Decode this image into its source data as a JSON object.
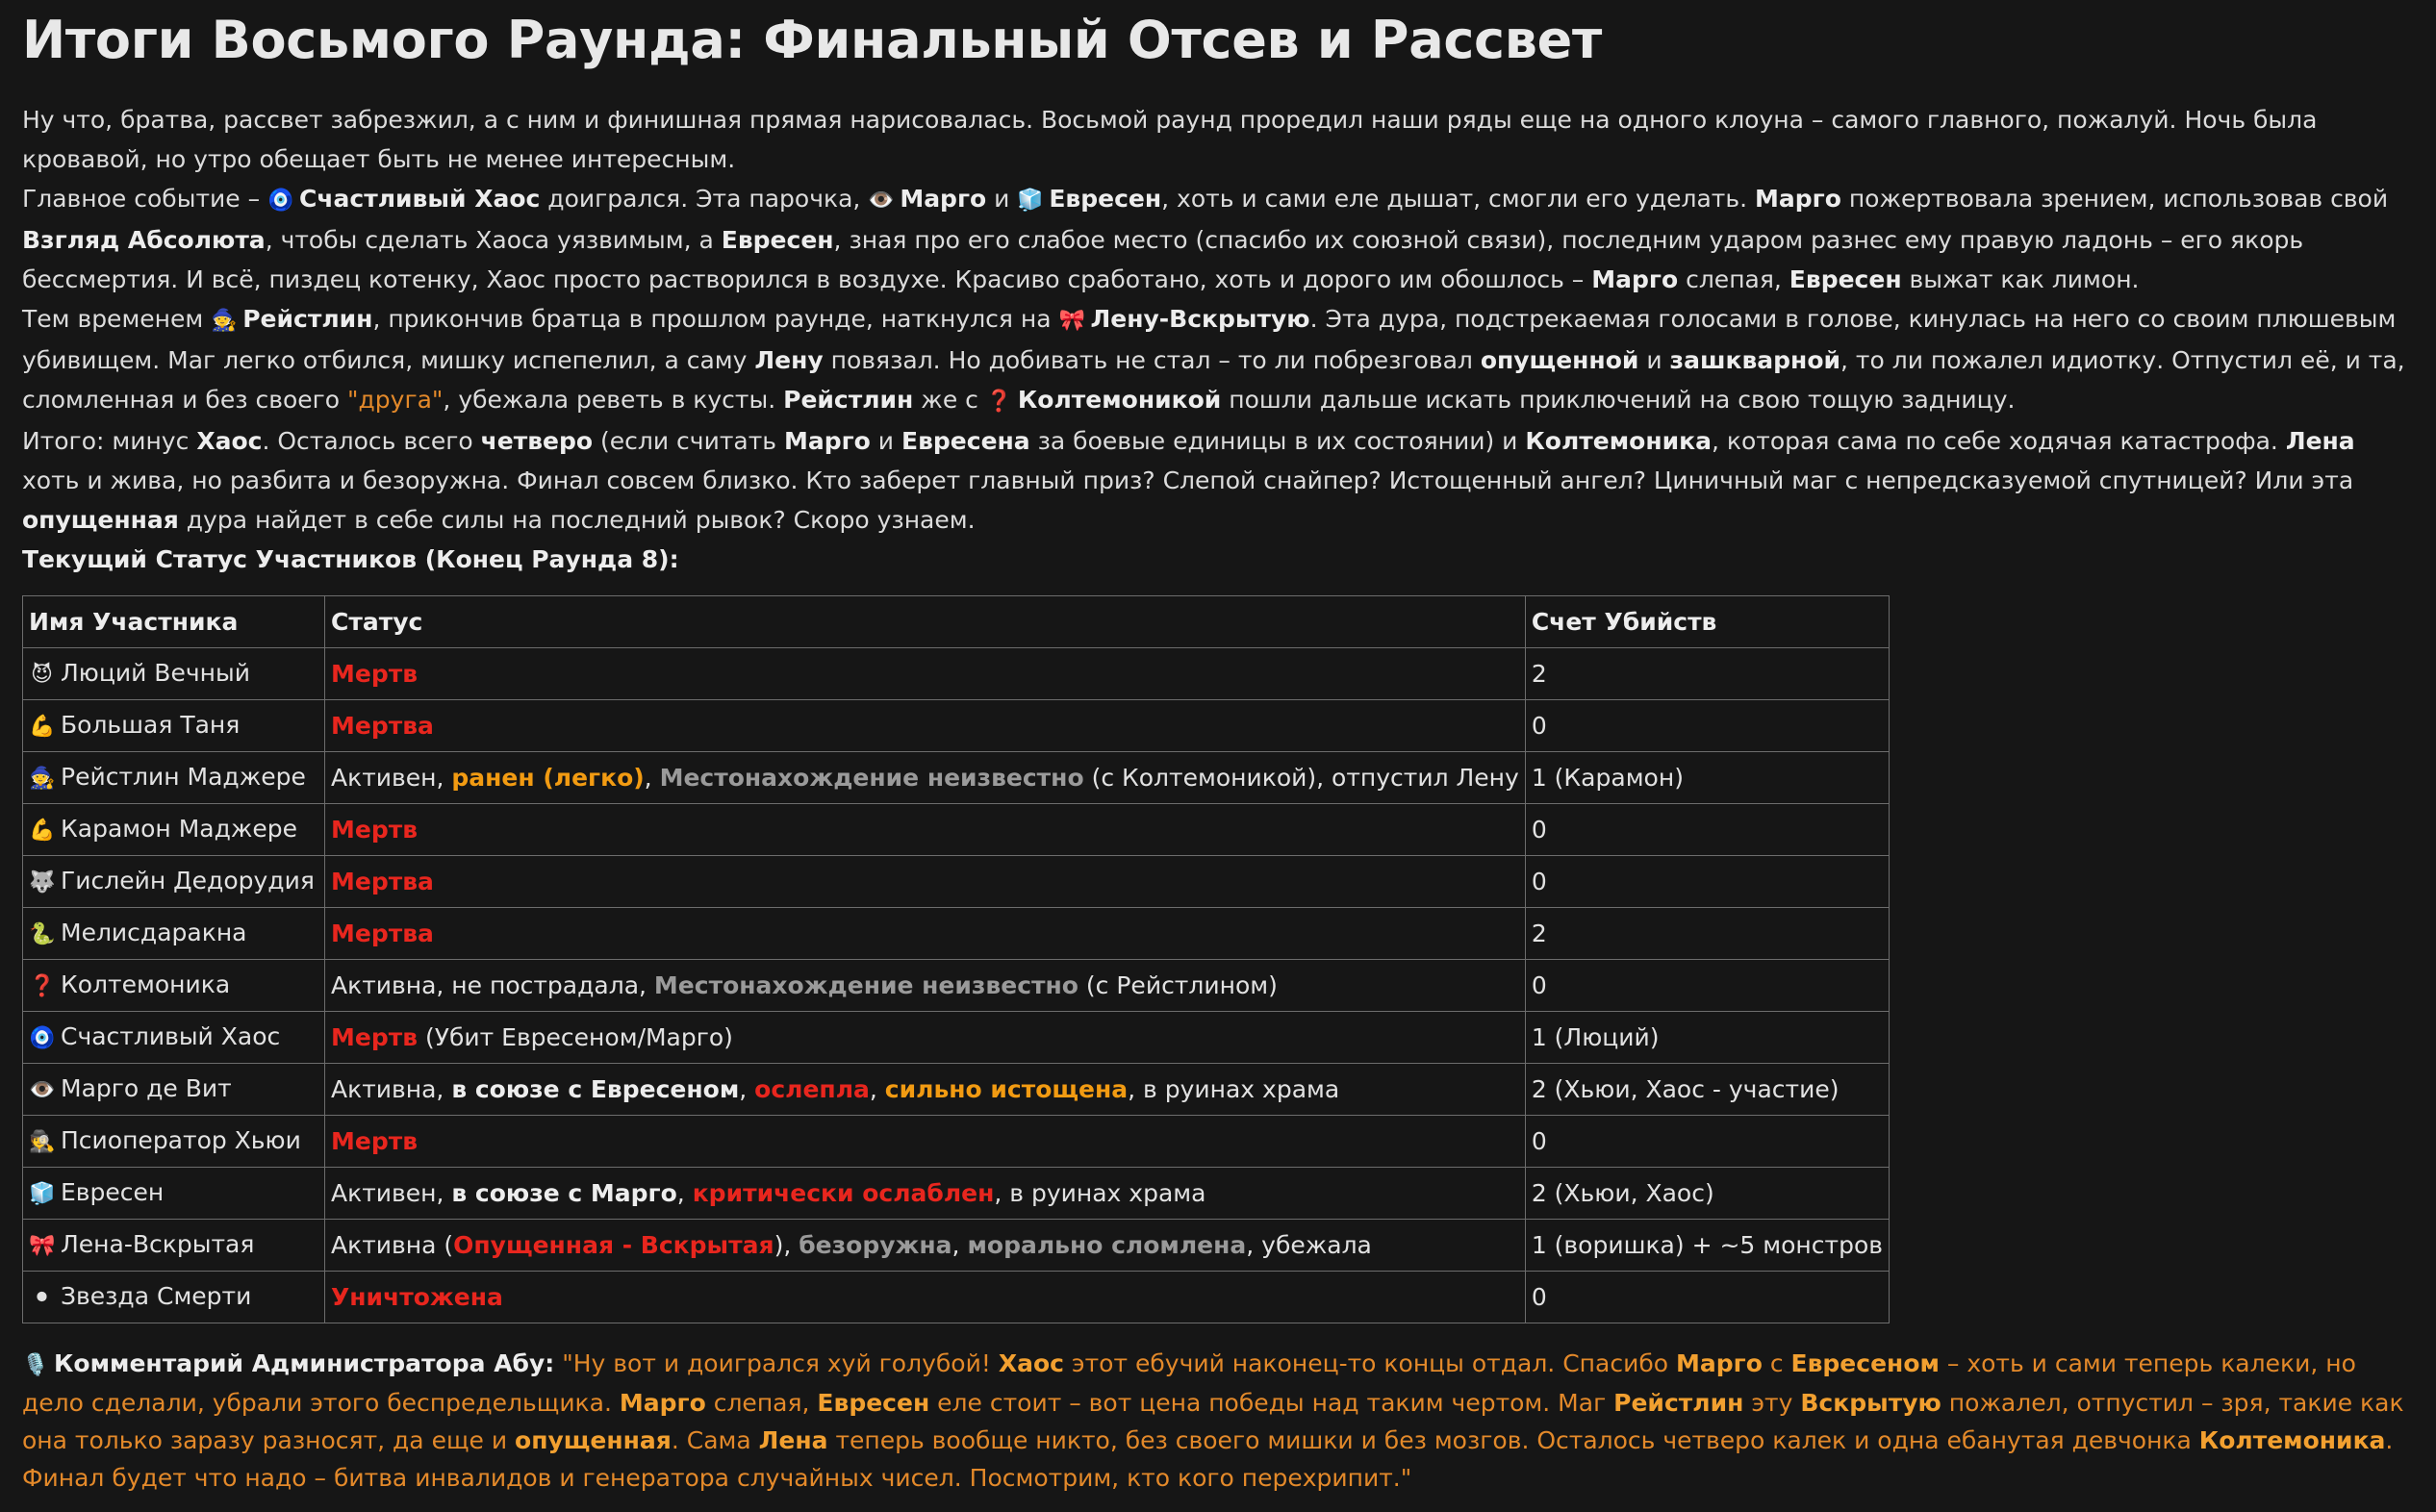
{
  "title": "Итоги Восьмого Раунда: Финальный Отсев и Рассвет",
  "p1": "Ну что, братва, рассвет забрезжил, а с ним и финишная прямая нарисовалась. Восьмой раунд проредил наши ряды еще на одного клоуна – самого главного, пожалуй. Ночь была кровавой, но утро обещает быть не менее интересным.",
  "p2": {
    "t1": "Главное событие – ",
    "n1": "Счастливый Хаос",
    "t2": " доигрался. Эта парочка, ",
    "n2": "Марго",
    "t3": " и ",
    "n3": "Евресен",
    "t4": ", хоть и сами еле дышат, смогли его уделать. ",
    "n4": "Марго",
    "t5": " пожертвовала зрением, использовав свой ",
    "n5": "Взгляд Абсолюта",
    "t6": ", чтобы сделать Хаоса уязвимым, а ",
    "n6": "Евресен",
    "t7": ", зная про его слабое место (спасибо их союзной связи), последним ударом разнес ему правую ладонь – его якорь бессмертия. И всё, пиздец котенку, Хаос просто растворился в воздухе. Красиво сработано, хоть и дорого им обошлось – ",
    "n7": "Марго",
    "t8": " слепая, ",
    "n8": "Евресен",
    "t9": " выжат как лимон."
  },
  "p3": {
    "t1": "Тем временем ",
    "n1": "Рейстлин",
    "t2": ", прикончив братца в прошлом раунде, наткнулся на ",
    "n2": "Лену-Вскрытую",
    "t3": ". Эта дура, подстрекаемая голосами в голове, кинулась на него со своим плюшевым убивищем. Маг легко отбился, мишку испепелил, а саму ",
    "n3": "Лену",
    "t4": " повязал. Но добивать не стал – то ли побрезговал ",
    "n4": "опущенной",
    "t5": " и ",
    "n5": "зашкварной",
    "t6": ", то ли пожалел идиотку. Отпустил её, и та, сломленная и без своего ",
    "q1": "\"друга\"",
    "t7": ", убежала реветь в кусты. ",
    "n6": "Рейстлин",
    "t8": " же с ",
    "n7": "Колтемоникой",
    "t9": " пошли дальше искать приключений на свою тощую задницу."
  },
  "p4": {
    "t1": "Итого: минус ",
    "n1": "Хаос",
    "t2": ". Осталось всего ",
    "n2": "четверо",
    "t3": " (если считать ",
    "n3": "Марго",
    "t4": " и ",
    "n4": "Евресена",
    "t5": " за боевые единицы в их состоянии) и ",
    "n5": "Колтемоника",
    "t6": ", которая сама по себе ходячая катастрофа. ",
    "n6": "Лена",
    "t7": " хоть и жива, но разбита и безоружна. Финал совсем близко. Кто заберет главный приз? Слепой снайпер? Истощенный ангел? Циничный маг с непредсказуемой спутницей? Или эта ",
    "n7": "опущенная",
    "t8": " дура найдет в себе силы на последний рывок? Скоро узнаем."
  },
  "status_heading": "Текущий Статус Участников (Конец Раунда 8):",
  "table": {
    "headers": [
      "Имя Участника",
      "Статус",
      "Счет Убийств"
    ],
    "rows": [
      {
        "icon": "😈",
        "name": "Люций Вечный",
        "kills": "2",
        "s": [
          "Мертв"
        ]
      },
      {
        "icon": "💪",
        "name": "Большая Таня",
        "kills": "0",
        "s": [
          "Мертва"
        ]
      },
      {
        "icon": "🧙",
        "name": "Рейстлин Маджере",
        "kills": "1 (Карамон)",
        "s": [
          "Активен, ",
          "ранен (легко)",
          ", ",
          "Местонахождение неизвестно",
          " (с Колтемоникой), отпустил Лену"
        ]
      },
      {
        "icon": "💪",
        "name": "Карамон Маджере",
        "kills": "0",
        "s": [
          "Мертв"
        ]
      },
      {
        "icon": "🐺",
        "name": "Гислейн Дедорудия",
        "kills": "0",
        "s": [
          "Мертва"
        ]
      },
      {
        "icon": "🐍",
        "name": "Мелисдаракна",
        "kills": "2",
        "s": [
          "Мертва"
        ]
      },
      {
        "icon": "❓",
        "name": "Колтемоника",
        "kills": "0",
        "s": [
          "Активна, не пострадала, ",
          "Местонахождение неизвестно",
          " (с Рейстлином)"
        ]
      },
      {
        "icon": "🧿",
        "name": "Счастливый Хаос",
        "kills": "1 (Люций)",
        "s": [
          "Мертв",
          " (Убит Евресеном/Марго)"
        ]
      },
      {
        "icon": "👁️",
        "name": "Марго де Вит",
        "kills": "2 (Хьюи, Хаос - участие)",
        "s": [
          "Активна, ",
          "в союзе с Евресеном",
          ", ",
          "ослепла",
          ", ",
          "сильно истощена",
          ", в руинах храма"
        ]
      },
      {
        "icon": "🕵",
        "name": "Псиоператор Хьюи",
        "kills": "0",
        "s": [
          "Мертв"
        ]
      },
      {
        "icon": "🧊",
        "name": "Евресен",
        "kills": "2 (Хьюи, Хаос)",
        "s": [
          "Активен, ",
          "в союзе с Марго",
          ", ",
          "критически ослаблен",
          ", в руинах храма"
        ]
      },
      {
        "icon": "🎀",
        "name": "Лена-Вскрытая",
        "kills": "1 (воришка) + ~5 монстров",
        "s": [
          "Активна (",
          "Опущенная - Вскрытая",
          "), ",
          "безоружна",
          ", ",
          "морально сломлена",
          ", убежала"
        ]
      },
      {
        "icon": "⚫",
        "name": "Звезда Смерти",
        "kills": "0",
        "s": [
          "Уничтожена"
        ]
      }
    ]
  },
  "admin": {
    "label": "Комментарий Администратора Абу:",
    "q": [
      "\"Ну вот и доигрался хуй голубой! ",
      "Хаос",
      " этот ебучий наконец-то концы отдал. Спасибо ",
      "Марго",
      " с ",
      "Евресеном",
      " – хоть и сами теперь калеки, но дело сделали, убрали этого беспредельщика. ",
      "Марго",
      " слепая, ",
      "Евресен",
      " еле стоит – вот цена победы над таким чертом. Маг ",
      "Рейстлин",
      " эту ",
      "Вскрытую",
      " пожалел, отпустил – зря, такие как она только заразу разносят, да еще и ",
      "опущенная",
      ". Сама ",
      "Лена",
      " теперь вообще никто, без своего мишки и без мозгов. Осталось четверо калек и одна ебанутая девчонка ",
      "Колтемоника",
      ". Финал будет что надо – битва инвалидов и генератора случайных чисел. Посмотрим, кто кого перехрипит.\""
    ]
  },
  "icons": {
    "chaos": "🧿",
    "eye": "👁️",
    "ice": "🧊",
    "mage": "🧙",
    "bow": "🎀",
    "question": "❓",
    "mic": "🎙️"
  },
  "colors": {
    "red": "#e8261e",
    "orange": "#f29b12",
    "gray": "#9a9a9a",
    "quote": "#e3892a"
  }
}
